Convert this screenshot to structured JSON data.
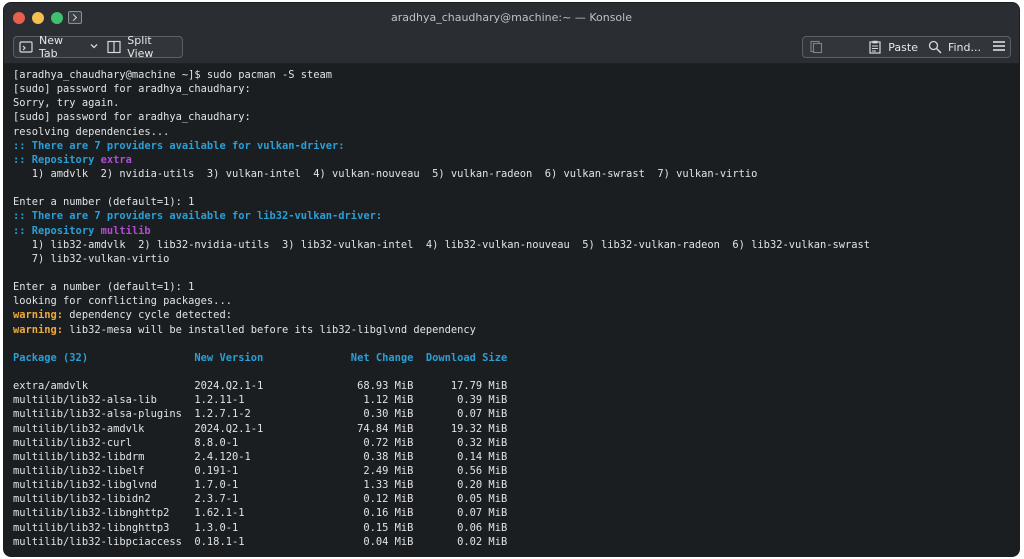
{
  "window": {
    "title": "aradhya_chaudhary@machine:~ — Konsole",
    "colors": {
      "close": "#e95e4f",
      "minimize": "#f4bf4f",
      "maximize": "#3fbf6f"
    }
  },
  "toolbar": {
    "new_tab": "New Tab",
    "split_view": "Split View",
    "paste": "Paste",
    "find": "Find..."
  },
  "terminal": {
    "prompt": "[aradhya_chaudhary@machine ~]$ sudo pacman -S steam",
    "sudo1": "[sudo] password for aradhya_chaudhary:",
    "sorry": "Sorry, try again.",
    "sudo2": "[sudo] password for aradhya_chaudhary:",
    "resolving": "resolving dependencies...",
    "providers1": ":: There are 7 providers available for vulkan-driver:",
    "repo1_prefix": ":: Repository ",
    "repo1_name": "extra",
    "options1": "   1) amdvlk  2) nvidia-utils  3) vulkan-intel  4) vulkan-nouveau  5) vulkan-radeon  6) vulkan-swrast  7) vulkan-virtio",
    "enter1": "Enter a number (default=1): 1",
    "providers2": ":: There are 7 providers available for lib32-vulkan-driver:",
    "repo2_prefix": ":: Repository ",
    "repo2_name": "multilib",
    "options2a": "   1) lib32-amdvlk  2) lib32-nvidia-utils  3) lib32-vulkan-intel  4) lib32-vulkan-nouveau  5) lib32-vulkan-radeon  6) lib32-vulkan-swrast",
    "options2b": "   7) lib32-vulkan-virtio",
    "enter2": "Enter a number (default=1): 1",
    "conflicts": "looking for conflicting packages...",
    "warn_label": "warning:",
    "warn1": " dependency cycle detected:",
    "warn2": " lib32-mesa will be installed before its lib32-libglvnd dependency",
    "table_header": "Package (32)                 New Version              Net Change  Download Size",
    "rows": [
      "extra/amdvlk                 2024.Q2.1-1               68.93 MiB      17.79 MiB",
      "multilib/lib32-alsa-lib      1.2.11-1                   1.12 MiB       0.39 MiB",
      "multilib/lib32-alsa-plugins  1.2.7.1-2                  0.30 MiB       0.07 MiB",
      "multilib/lib32-amdvlk        2024.Q2.1-1               74.84 MiB      19.32 MiB",
      "multilib/lib32-curl          8.8.0-1                    0.72 MiB       0.32 MiB",
      "multilib/lib32-libdrm        2.4.120-1                  0.38 MiB       0.14 MiB",
      "multilib/lib32-libelf        0.191-1                    2.49 MiB       0.56 MiB",
      "multilib/lib32-libglvnd      1.7.0-1                    1.33 MiB       0.20 MiB",
      "multilib/lib32-libidn2       2.3.7-1                    0.12 MiB       0.05 MiB",
      "multilib/lib32-libnghttp2    1.62.1-1                   0.16 MiB       0.07 MiB",
      "multilib/lib32-libnghttp3    1.3.0-1                    0.15 MiB       0.06 MiB",
      "multilib/lib32-libpciaccess  0.18.1-1                   0.04 MiB       0.02 MiB"
    ]
  }
}
